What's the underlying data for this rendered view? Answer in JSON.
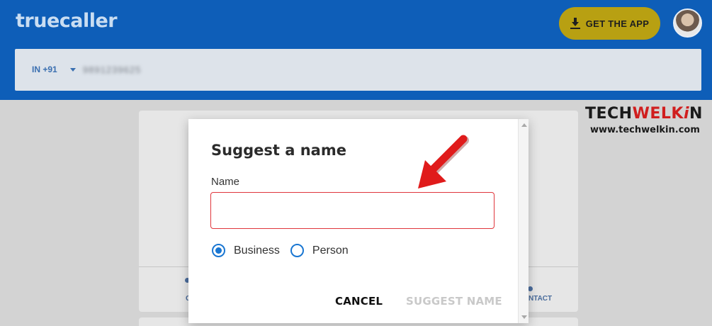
{
  "header": {
    "logo": "truecaller",
    "get_app_label": "GET THE APP"
  },
  "search": {
    "country_code": "IN +91",
    "phone_value": "9891239625"
  },
  "card_actions": {
    "left_fragment": "C",
    "right_fragment": "NTACT"
  },
  "watermark": {
    "brand_dark": "TECH",
    "brand_red": "WELK",
    "brand_i": "i",
    "brand_n": "N",
    "url": "www.techwelkin.com"
  },
  "dialog": {
    "title": "Suggest a name",
    "name_label": "Name",
    "name_value": "",
    "options": [
      {
        "label": "Business",
        "selected": true
      },
      {
        "label": "Person",
        "selected": false
      }
    ],
    "cancel_label": "CANCEL",
    "suggest_label": "SUGGEST NAME"
  },
  "colors": {
    "header_blue": "#0e5eb8",
    "get_app_gold": "#b8a012",
    "input_border_error": "#e0363c",
    "radio_blue": "#1976d2",
    "arrow_red": "#e01b1b"
  }
}
